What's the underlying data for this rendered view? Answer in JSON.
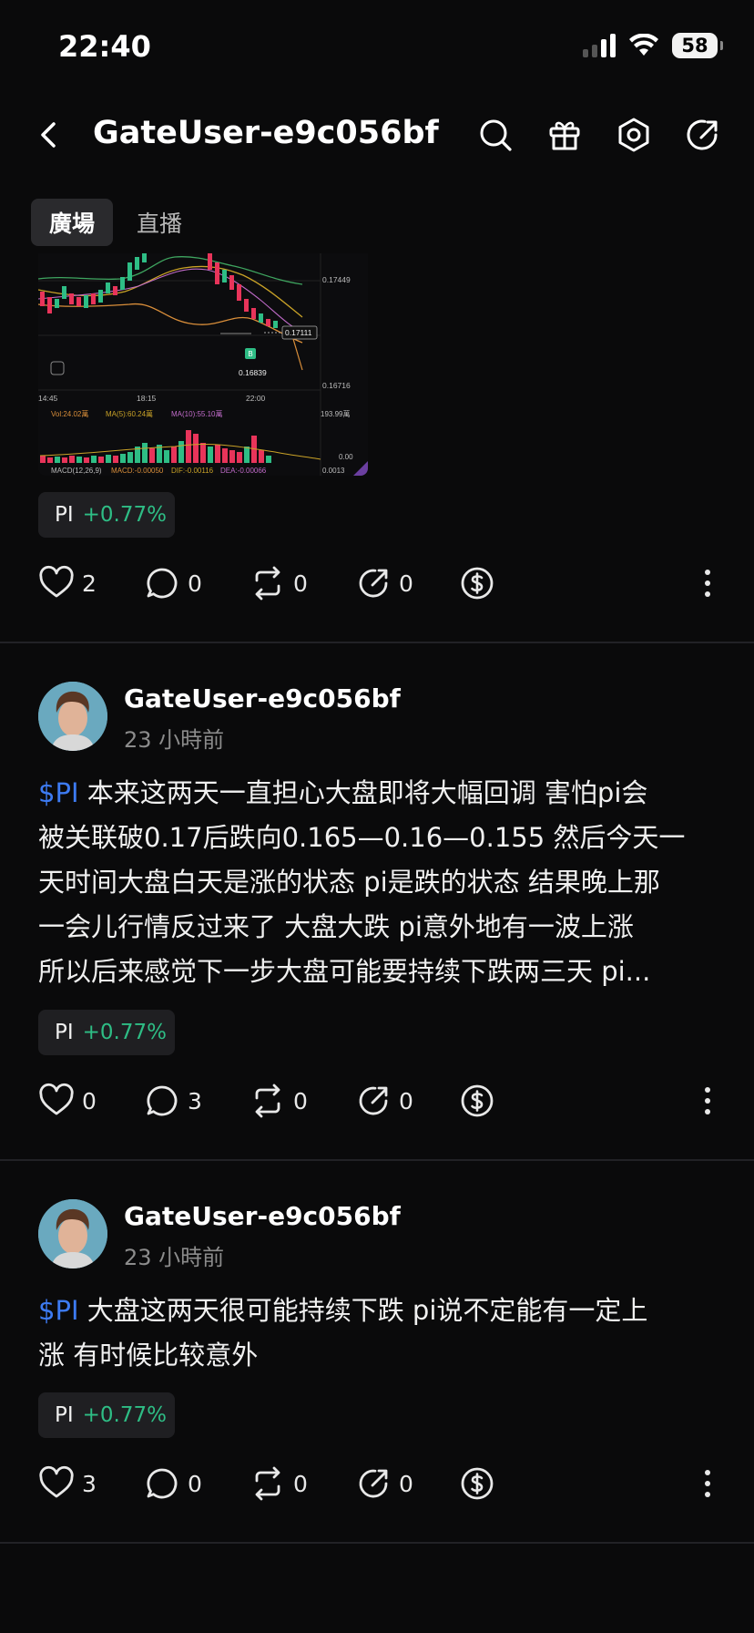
{
  "status_bar": {
    "time": "22:40",
    "battery": "58"
  },
  "header": {
    "title": "GateUser-e9c056bf"
  },
  "tabs": [
    {
      "label": "廣場",
      "active": true
    },
    {
      "label": "直播",
      "active": false
    }
  ],
  "chart_image": {
    "price_labels": [
      "0.17449",
      "0.17111",
      "0.16716"
    ],
    "marker_price": "0.16839",
    "time_labels": [
      "14:45",
      "18:15",
      "22:00"
    ],
    "vol_line": {
      "vol": "Vol:24.02萬",
      "ma5": "MA(5):60.24萬",
      "ma10": "MA(10):55.10萬",
      "right": "193.99萬"
    },
    "macd_line": {
      "macd": "MACD(12,26,9)",
      "val": "MACD:-0.00050",
      "dif": "DIF:-0.00116",
      "dea": "DEA:-0.00066",
      "right": "0.0013",
      "zero": "0.00"
    },
    "buy_marker": "B"
  },
  "posts": [
    {
      "coin": {
        "symbol": "PI",
        "change": "+0.77%"
      },
      "likes": "2",
      "comments": "0",
      "reposts": "0",
      "shares": "0"
    },
    {
      "author": "GateUser-e9c056bf",
      "time": "23 小時前",
      "cashtag": "$PI",
      "lines": [
        " 本来这两天一直担心大盘即将大幅回调 害怕pi会",
        "被关联破0.17后跌向0.165—0.16—0.155 然后今天一",
        "天时间大盘白天是涨的状态 pi是跌的状态 结果晚上那",
        "一会儿行情反过来了 大盘大跌 pi意外地有一波上涨",
        "所以后来感觉下一步大盘可能要持续下跌两三天 pi..."
      ],
      "coin": {
        "symbol": "PI",
        "change": "+0.77%"
      },
      "likes": "0",
      "comments": "3",
      "reposts": "0",
      "shares": "0"
    },
    {
      "author": "GateUser-e9c056bf",
      "time": "23 小時前",
      "cashtag": "$PI",
      "lines": [
        " 大盘这两天很可能持续下跌 pi说不定能有一定上",
        "涨 有时候比较意外"
      ],
      "coin": {
        "symbol": "PI",
        "change": "+0.77%"
      },
      "likes": "3",
      "comments": "0",
      "reposts": "0",
      "shares": "0"
    }
  ],
  "colors": {
    "up": "#2ebd85",
    "down": "#e8345a",
    "link": "#3d7bf2"
  },
  "icons": [
    "chevron-left-icon",
    "search-icon",
    "gift-icon",
    "settings-hexagon-icon",
    "share-icon",
    "heart-icon",
    "comment-icon",
    "repost-icon",
    "forward-icon",
    "tip-dollar-icon",
    "more-vertical-icon"
  ]
}
